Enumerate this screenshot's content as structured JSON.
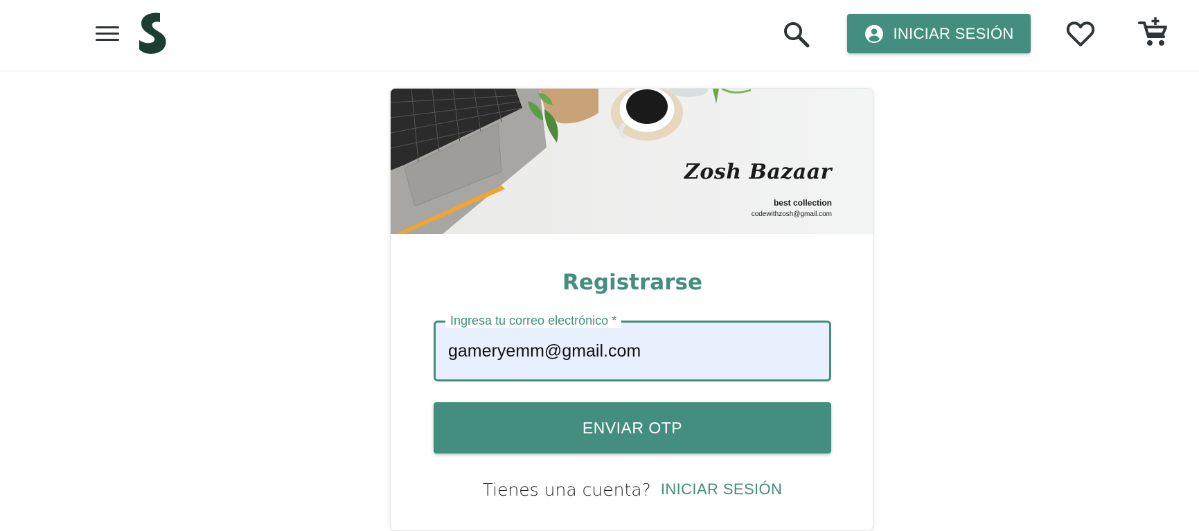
{
  "header": {
    "login_label": "INICIAR SESIÓN"
  },
  "banner": {
    "store_name": "Zosh Bazaar",
    "tagline": "best collection",
    "email": "codewithzosh@gmail.com"
  },
  "form": {
    "title": "Registrarse",
    "email_label": "Ingresa tu correo electrónico *",
    "email_value": "gameryemm@gmail.com",
    "submit_label": "ENVIAR OTP",
    "have_account_text": "Tienes una cuenta?",
    "login_link_label": "INICIAR SESIÓN"
  },
  "colors": {
    "accent": "#438e7e",
    "logo": "#1d3d33",
    "input_bg": "#e8f0fe",
    "icon": "#2f3437"
  },
  "icons": [
    "menu-icon",
    "logo-icon",
    "search-icon",
    "account-circle-icon",
    "heart-icon",
    "add-cart-icon"
  ]
}
